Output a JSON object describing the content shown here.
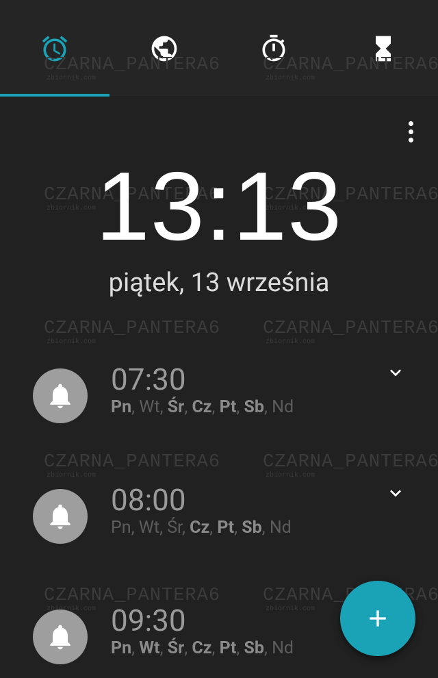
{
  "tabs": [
    {
      "icon": "alarm-clock-icon",
      "active": true
    },
    {
      "icon": "globe-icon",
      "active": false
    },
    {
      "icon": "stopwatch-icon",
      "active": false
    },
    {
      "icon": "hourglass-icon",
      "active": false
    }
  ],
  "accent_color": "#1aa3b6",
  "watermark": {
    "text": "CZARNA_PANTERA6",
    "sub": "zbiornik.com"
  },
  "clock": {
    "time": "13:13",
    "date": "piątek, 13 września"
  },
  "alarms": [
    {
      "time": "07:30",
      "days": [
        {
          "label": "Pn",
          "on": true
        },
        {
          "label": "Wt",
          "on": false
        },
        {
          "label": "Śr",
          "on": true
        },
        {
          "label": "Cz",
          "on": true
        },
        {
          "label": "Pt",
          "on": true
        },
        {
          "label": "Sb",
          "on": true
        },
        {
          "label": "Nd",
          "on": false
        }
      ]
    },
    {
      "time": "08:00",
      "days": [
        {
          "label": "Pn",
          "on": false
        },
        {
          "label": "Wt",
          "on": false
        },
        {
          "label": "Śr",
          "on": false
        },
        {
          "label": "Cz",
          "on": true
        },
        {
          "label": "Pt",
          "on": true
        },
        {
          "label": "Sb",
          "on": true
        },
        {
          "label": "Nd",
          "on": false
        }
      ]
    },
    {
      "time": "09:30",
      "days": [
        {
          "label": "Pn",
          "on": true
        },
        {
          "label": "Wt",
          "on": true
        },
        {
          "label": "Śr",
          "on": true
        },
        {
          "label": "Cz",
          "on": true
        },
        {
          "label": "Pt",
          "on": true
        },
        {
          "label": "Sb",
          "on": true
        },
        {
          "label": "Nd",
          "on": false
        }
      ]
    }
  ],
  "fab": {
    "icon": "plus-icon"
  }
}
